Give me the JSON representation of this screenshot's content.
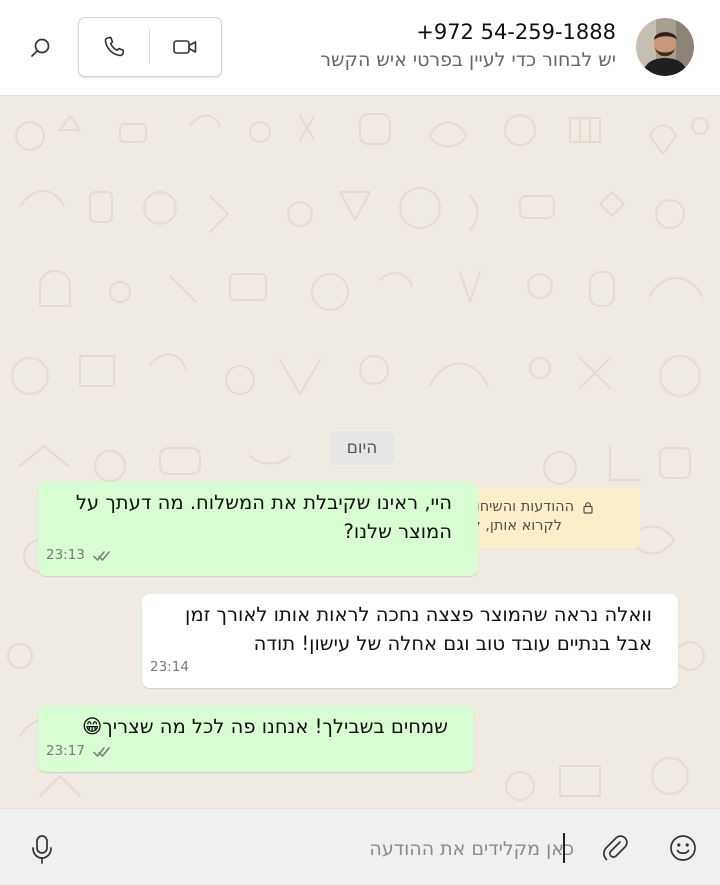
{
  "header": {
    "contact_number": "+972 54-259-1888",
    "contact_subtitle": "יש לבחור כדי לעיין בפרטי איש הקשר"
  },
  "chat": {
    "day_label": "היום",
    "encryption_notice_line1": "ההודעות והשיחות מוצפנות מקצה לקצה ורק האנשים בצ'אט הזה יכולים",
    "encryption_notice_line2": "לקרוא אותן, להאזין להן ולשתף אותן. אפשר להקיש למידע נוסף.",
    "messages": [
      {
        "direction": "outgoing",
        "line1": "היי, ראינו שקיבלת את המשלוח. מה דעתך על",
        "line2": "המוצר שלנו?",
        "time": "23:13",
        "status": "read"
      },
      {
        "direction": "incoming",
        "line1": "וואלה נראה שהמוצר פצצה נחכה לראות אותו לאורך זמן",
        "line2": "אבל בנתיים עובד טוב וגם אחלה של עישון! תודה",
        "time": "23:14"
      },
      {
        "direction": "outgoing",
        "line1": "שמחים בשבילך! אנחנו פה לכל מה שצריך😁",
        "time": "23:17",
        "status": "read"
      }
    ]
  },
  "composer": {
    "placeholder": "כאן מקלידים את ההודעה"
  },
  "icons": {
    "search": "search-icon",
    "voice_call": "phone-icon",
    "video_call": "video-camera-icon",
    "emoji": "smiley-icon",
    "attach": "paperclip-icon",
    "mic": "microphone-icon",
    "read_receipt": "double-check-icon",
    "lock": "lock-icon"
  },
  "colors": {
    "outgoing_bubble": "#d9fdd3",
    "incoming_bubble": "#ffffff",
    "chat_background": "#efeae2",
    "notice_background": "#fbefc7",
    "read_tick": "#7a7a7a"
  }
}
